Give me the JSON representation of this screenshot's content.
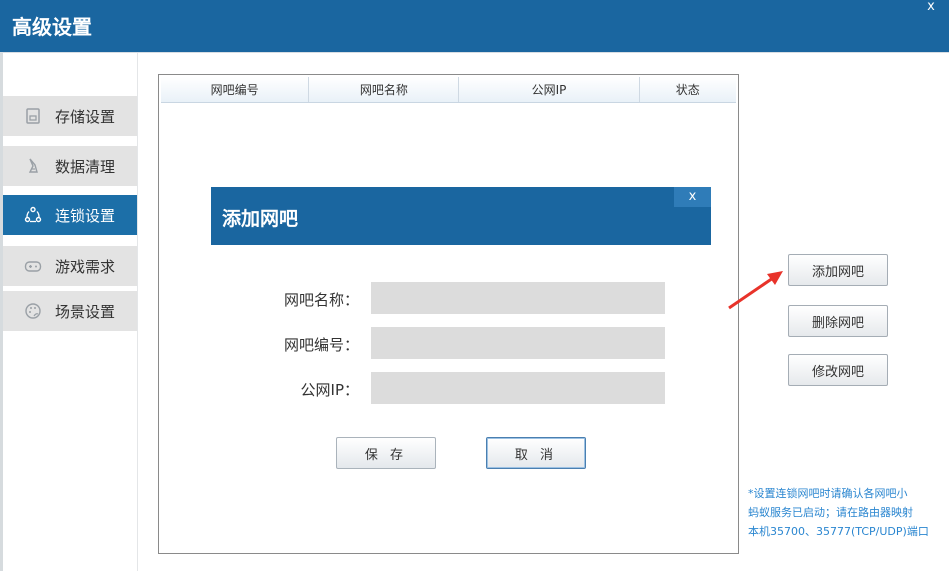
{
  "window": {
    "title": "高级设置",
    "close_glyph": "x"
  },
  "sidebar": {
    "items": [
      {
        "label": "存储设置",
        "icon": "storage-icon",
        "active": false
      },
      {
        "label": "数据清理",
        "icon": "broom-icon",
        "active": false
      },
      {
        "label": "连锁设置",
        "icon": "network-icon",
        "active": true
      },
      {
        "label": "游戏需求",
        "icon": "gamepad-icon",
        "active": false
      },
      {
        "label": "场景设置",
        "icon": "palette-icon",
        "active": false
      }
    ]
  },
  "table": {
    "columns": [
      "网吧编号",
      "网吧名称",
      "公网IP",
      "状态"
    ],
    "rows": []
  },
  "dialog": {
    "title": "添加网吧",
    "close_glyph": "x",
    "fields": [
      {
        "label": "网吧名称：",
        "value": ""
      },
      {
        "label": "网吧编号：",
        "value": ""
      },
      {
        "label": "公网IP：",
        "value": ""
      }
    ],
    "save_label": "保 存",
    "cancel_label": "取 消"
  },
  "actions": {
    "add_label": "添加网吧",
    "delete_label": "删除网吧",
    "edit_label": "修改网吧"
  },
  "note": {
    "line1": "*设置连锁网吧时请确认各网吧小",
    "line2": "蚂蚁服务已启动；请在路由器映射",
    "line3": "本机35700、35777(TCP/UDP)端口"
  },
  "colors": {
    "title_bar": "#1a66a0",
    "active_nav": "#1c6fa8",
    "note_text": "#2a86d0",
    "arrow": "#e8332a"
  }
}
